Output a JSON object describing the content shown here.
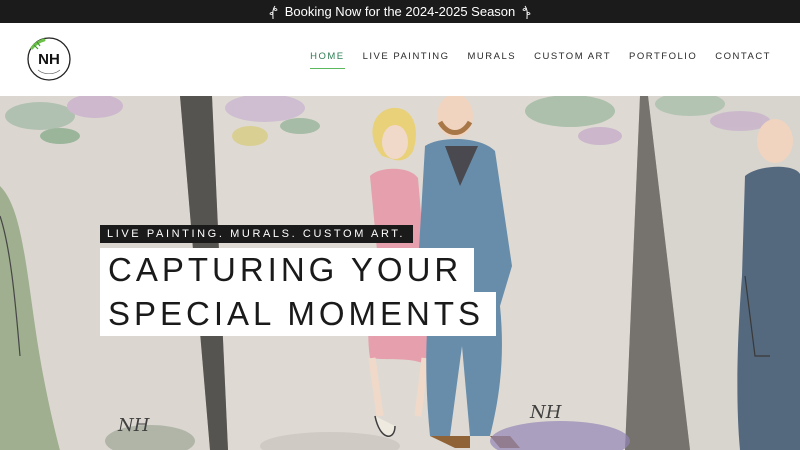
{
  "announcement": {
    "text": "Booking Now for the 2024-2025 Season"
  },
  "logo": {
    "monogram": "NH",
    "ring_text": "NICOLE HERN ART"
  },
  "nav": {
    "items": [
      {
        "label": "HOME",
        "active": true
      },
      {
        "label": "LIVE PAINTING",
        "active": false
      },
      {
        "label": "MURALS",
        "active": false
      },
      {
        "label": "CUSTOM ART",
        "active": false
      },
      {
        "label": "PORTFOLIO",
        "active": false
      },
      {
        "label": "CONTACT",
        "active": false
      }
    ]
  },
  "hero": {
    "tagline": "LIVE PAINTING. MURALS. CUSTOM ART.",
    "headline_line1": "CAPTURING YOUR",
    "headline_line2": "SPECIAL MOMENTS",
    "signature_left": "NH",
    "signature_right": "NH"
  },
  "colors": {
    "accent": "#5cb85c",
    "announce_bg": "#1b1b1b",
    "nav_active": "#2e7d55"
  }
}
